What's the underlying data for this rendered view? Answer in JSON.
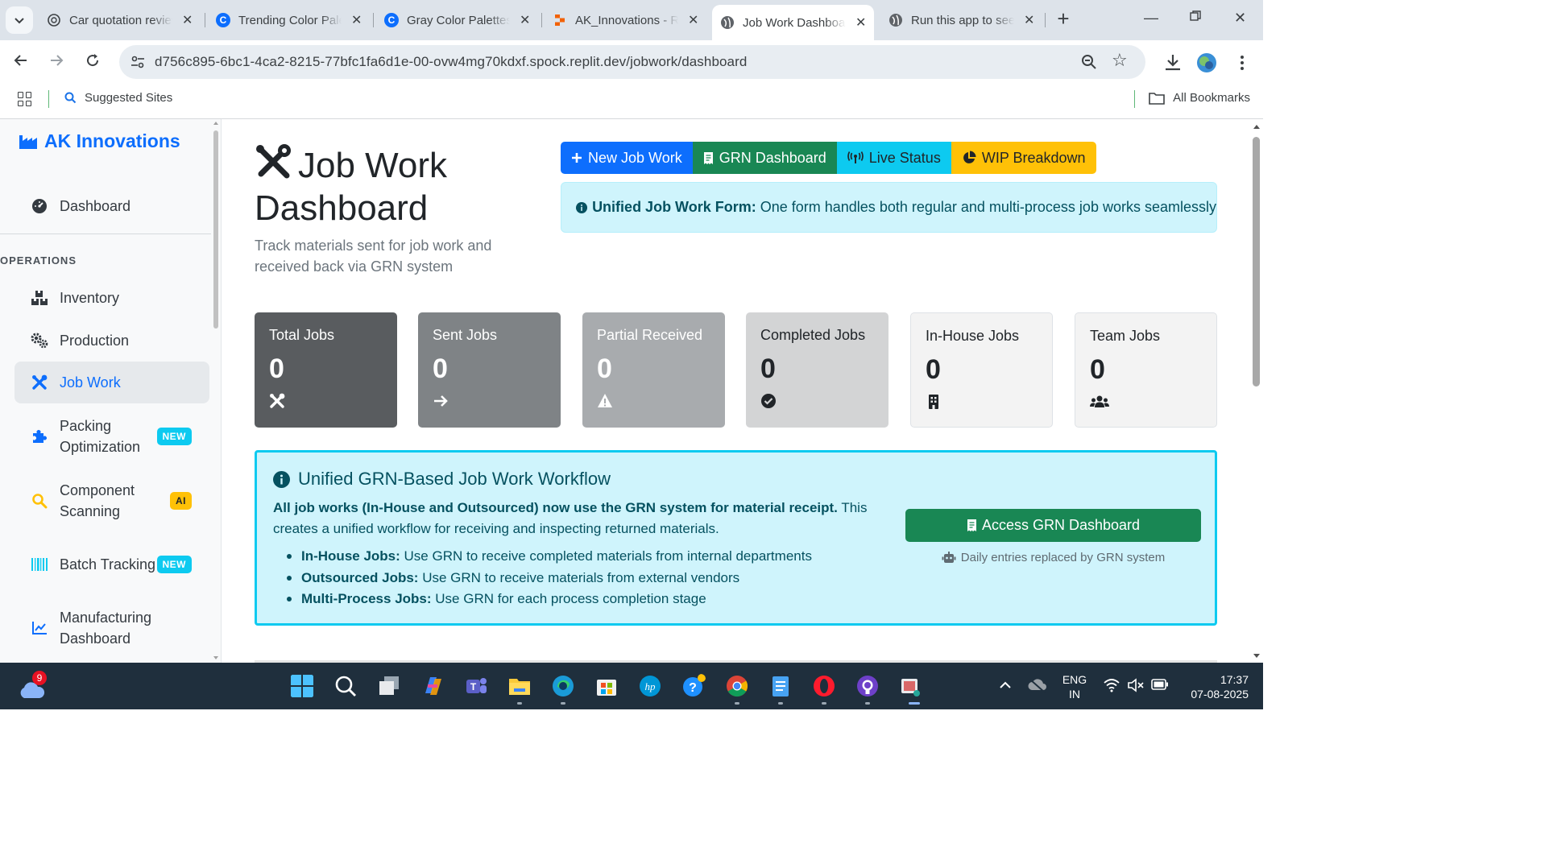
{
  "browser": {
    "tabs": [
      {
        "title": "Car quotation review",
        "favicon": "openai-icon",
        "active": false
      },
      {
        "title": "Trending Color Palettes",
        "favicon": "coolors-icon",
        "active": false
      },
      {
        "title": "Gray Color Palettes",
        "favicon": "coolors-icon",
        "active": false
      },
      {
        "title": "AK_Innovations - Replit",
        "favicon": "replit-icon",
        "active": false
      },
      {
        "title": "Job Work Dashboard",
        "favicon": "globe-icon",
        "active": true
      },
      {
        "title": "Run this app to see",
        "favicon": "globe-icon",
        "active": false
      }
    ],
    "url": "d756c895-6bc1-4ca2-8215-77bfc1fa6d1e-00-ovw4mg70kdxf.spock.replit.dev/jobwork/dashboard",
    "bookmarks": {
      "suggested": "Suggested Sites",
      "all": "All Bookmarks"
    }
  },
  "sidebar": {
    "brand": "AK Innovations",
    "dashboard": "Dashboard",
    "section_heading": "OPERATIONS",
    "items": [
      {
        "label": "Inventory",
        "icon": "boxes-icon"
      },
      {
        "label": "Production",
        "icon": "cogs-icon"
      },
      {
        "label": "Job Work",
        "icon": "tools-icon",
        "active": true
      },
      {
        "label": "Packing Optimization",
        "icon": "puzzle-icon",
        "badge": "NEW"
      },
      {
        "label": "Component Scanning",
        "icon": "search-icon",
        "badge": "AI"
      },
      {
        "label": "Batch Tracking",
        "icon": "barcode-icon",
        "badge": "NEW"
      },
      {
        "label": "Manufacturing Dashboard",
        "icon": "chart-line-icon"
      }
    ]
  },
  "main": {
    "title": "Job Work Dashboard",
    "subtitle": "Track materials sent for job work and received back via GRN system",
    "actions": [
      {
        "label": "New Job Work",
        "icon": "plus-icon"
      },
      {
        "label": "GRN Dashboard",
        "icon": "receipt-icon"
      },
      {
        "label": "Live Status",
        "icon": "broadcast-icon"
      },
      {
        "label": "WIP Breakdown",
        "icon": "pie-chart-icon"
      }
    ],
    "info_alert": {
      "bold": "Unified Job Work Form:",
      "text": "One form handles both regular and multi-process job works seamlessly"
    },
    "stats": [
      {
        "label": "Total Jobs",
        "value": "0",
        "icon": "tools-icon",
        "bg": "#595c5f",
        "fg": "#ffffff"
      },
      {
        "label": "Sent Jobs",
        "value": "0",
        "icon": "arrow-right-icon",
        "bg": "#7f8386",
        "fg": "#ffffff"
      },
      {
        "label": "Partial Received",
        "value": "0",
        "icon": "warning-icon",
        "bg": "#a8abae",
        "fg": "#ffffff"
      },
      {
        "label": "Completed Jobs",
        "value": "0",
        "icon": "check-circle-icon",
        "bg": "#d3d4d5",
        "fg": "#212529"
      },
      {
        "label": "In-House Jobs",
        "value": "0",
        "icon": "building-icon",
        "bg": "#f3f3f3",
        "fg": "#212529"
      },
      {
        "label": "Team Jobs",
        "value": "0",
        "icon": "users-icon",
        "bg": "#f3f3f3",
        "fg": "#212529"
      }
    ],
    "workflow": {
      "title": "Unified GRN-Based Job Work Workflow",
      "lead_bold": "All job works (In-House and Outsourced) now use the GRN system for material receipt.",
      "lead_text": "This creates a unified workflow for receiving and inspecting returned materials.",
      "items": [
        {
          "bold": "In-House Jobs:",
          "text": "Use GRN to receive completed materials from internal departments"
        },
        {
          "bold": "Outsourced Jobs:",
          "text": "Use GRN to receive materials from external vendors"
        },
        {
          "bold": "Multi-Process Jobs:",
          "text": "Use GRN for each process completion stage"
        }
      ],
      "button": "Access GRN Dashboard",
      "note": "Daily entries replaced by GRN system"
    }
  },
  "taskbar": {
    "weather_badge": "9",
    "lang_top": "ENG",
    "lang_bottom": "IN",
    "time": "17:37",
    "date": "07-08-2025"
  },
  "colors": {
    "primary": "#0d6efd",
    "success": "#198754",
    "info": "#0dcaf0",
    "warning": "#ffc107",
    "info_bg": "#cff4fc",
    "info_text": "#055160"
  }
}
